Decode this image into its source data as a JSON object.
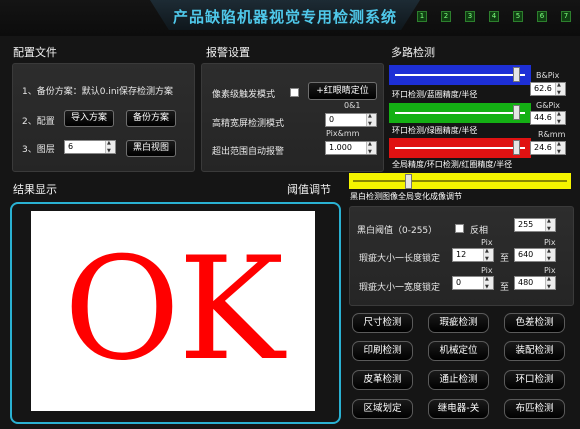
{
  "app": {
    "title": "产品缺陷机器视觉专用检测系统",
    "indicators": [
      "1",
      "2",
      "3",
      "4",
      "5",
      "6",
      "7"
    ]
  },
  "config": {
    "section_title": "配置文件",
    "row1": {
      "label": "1、备份方案：默认0.ini保存检测方案"
    },
    "row2": {
      "label": "2、配置",
      "import_button": "导入方案",
      "backup_button": "备份方案"
    },
    "row3": {
      "label": "3、图层",
      "layer_value": "6",
      "bw_view_button": "黑白视图"
    }
  },
  "alarm": {
    "section_title": "报警设置",
    "pixel_trigger": {
      "label": "像素级触发模式",
      "checked": false
    },
    "red_eye_button": "+红眼睛定位",
    "range_hint": "0&1",
    "wide_screen": {
      "label": "高精宽屏检测模式",
      "value": "0"
    },
    "unit_hint": "Pix&mm",
    "auto_alarm": {
      "label": "超出范围自动报警",
      "value": "1.000"
    }
  },
  "multi": {
    "section_title": "多路检测",
    "channels": [
      {
        "color": "#1d2fd6",
        "unit": "B&Pix",
        "caption": "环口检测/蓝圈精度/半径",
        "value": "62.6",
        "level": 0.92
      },
      {
        "color": "#14b014",
        "unit": "G&Pix",
        "caption": "环口检测/绿圈精度/半径",
        "value": "44.6",
        "level": 0.92
      },
      {
        "color": "#e01212",
        "unit": "R&mm",
        "caption": "全局精度/环口检测/红圈精度/半径",
        "value": "24.6",
        "level": 0.92
      }
    ]
  },
  "result": {
    "section_title": "结果显示",
    "text": "OK"
  },
  "threshold": {
    "section_title": "阈值调节",
    "bar_caption": "黑白检测图像全局变化成像调节",
    "bar_level": 0.26,
    "bw_threshold": {
      "label": "黑白阈值（0-255）",
      "invert_label": "反相",
      "invert_checked": false,
      "value": "255"
    },
    "length_lock": {
      "label": "瑕疵大小一长度锁定",
      "min": "12",
      "to": "至",
      "max": "640",
      "unit": "Pix"
    },
    "width_lock": {
      "label": "瑕疵大小一宽度锁定",
      "min": "0",
      "to": "至",
      "max": "480",
      "unit": "Pix"
    }
  },
  "tools": [
    "尺寸检测",
    "瑕疵检测",
    "色差检测",
    "印刷检测",
    "机械定位",
    "装配检测",
    "皮革检测",
    "通止检测",
    "环口检测",
    "区域划定",
    "继电器-关",
    "布匹检测"
  ],
  "colors": {
    "accent": "#2ab1d2",
    "title": "#4fc8ea",
    "ok_text": "#ff0000",
    "yellow_bar": "#f5f500"
  }
}
